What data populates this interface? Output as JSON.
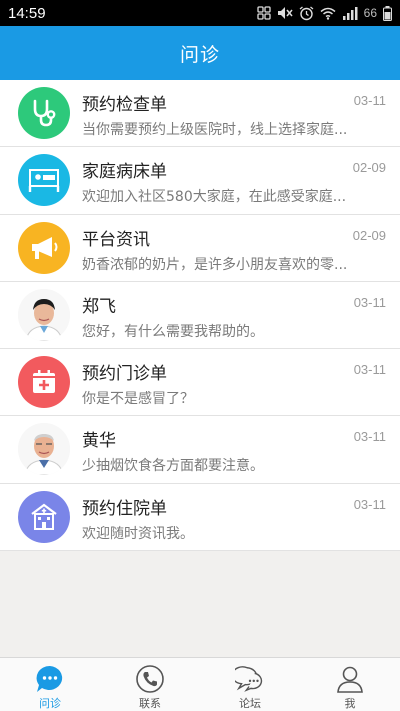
{
  "status_bar": {
    "time": "14:59",
    "battery": "66"
  },
  "header": {
    "title": "问诊"
  },
  "colors": {
    "accent": "#1a9ae4"
  },
  "messages": [
    {
      "title": "预约检查单",
      "preview": "当你需要预约上级医院时，线上选择家庭...",
      "date": "03-11",
      "icon": "stethoscope-icon",
      "color": "#2dc97b"
    },
    {
      "title": "家庭病床单",
      "preview": "欢迎加入社区580大家庭，在此感受家庭...",
      "date": "02-09",
      "icon": "hospital-bed-icon",
      "color": "#1ab8e4"
    },
    {
      "title": "平台资讯",
      "preview": "奶香浓郁的奶片，是许多小朋友喜欢的零...",
      "date": "02-09",
      "icon": "megaphone-icon",
      "color": "#f8b422"
    },
    {
      "title": "郑飞",
      "preview": "您好，有什么需要我帮助的。",
      "date": "03-11",
      "icon": "doctor-avatar",
      "color": "#ffffff"
    },
    {
      "title": "预约门诊单",
      "preview": "你是不是感冒了？",
      "date": "03-11",
      "icon": "calendar-plus-icon",
      "color": "#f25a5e"
    },
    {
      "title": "黄华",
      "preview": "少抽烟饮食各方面都要注意。",
      "date": "03-11",
      "icon": "doctor-avatar",
      "color": "#ffffff"
    },
    {
      "title": "预约住院单",
      "preview": "欢迎随时资讯我。",
      "date": "03-11",
      "icon": "hospital-building-icon",
      "color": "#7a85e8"
    }
  ],
  "nav": [
    {
      "label": "问诊",
      "icon": "chat-icon",
      "active": true
    },
    {
      "label": "联系",
      "icon": "phone-icon",
      "active": false
    },
    {
      "label": "论坛",
      "icon": "forum-icon",
      "active": false
    },
    {
      "label": "我",
      "icon": "profile-icon",
      "active": false
    }
  ]
}
